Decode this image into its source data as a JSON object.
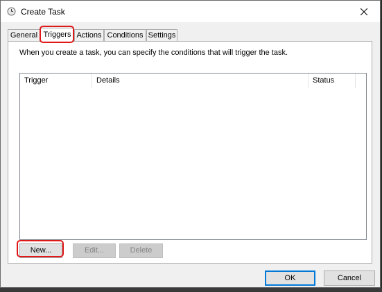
{
  "window": {
    "title": "Create Task"
  },
  "tabs": [
    {
      "label": "General",
      "active": false
    },
    {
      "label": "Triggers",
      "active": true
    },
    {
      "label": "Actions",
      "active": false
    },
    {
      "label": "Conditions",
      "active": false
    },
    {
      "label": "Settings",
      "active": false
    }
  ],
  "triggers": {
    "description": "When you create a task, you can specify the conditions that will trigger the task.",
    "columns": [
      "Trigger",
      "Details",
      "Status"
    ],
    "rows": [],
    "new_label": "New...",
    "edit_label": "Edit...",
    "delete_label": "Delete"
  },
  "footer": {
    "ok_label": "OK",
    "cancel_label": "Cancel"
  },
  "colors": {
    "highlight": "#e01818",
    "accent": "#0078d7"
  }
}
